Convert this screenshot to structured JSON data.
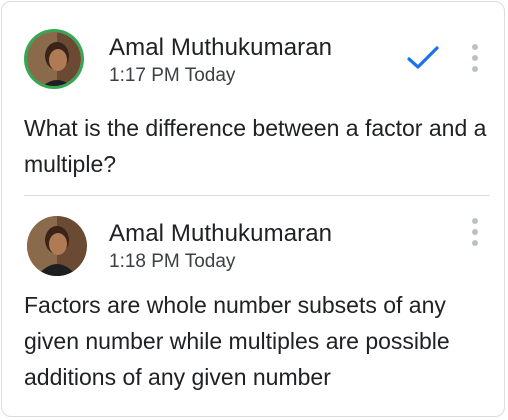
{
  "comments": [
    {
      "author": "Amal Muthukumaran",
      "time": "1:17 PM Today",
      "text": "What is the difference between a factor and a multiple?"
    },
    {
      "author": "Amal Muthukumaran",
      "time": "1:18 PM Today",
      "text": "Factors are whole number subsets of any given number while multiples are possible additions of any given number"
    }
  ],
  "icons": {
    "resolve": "checkmark-icon",
    "menu": "more-vert-icon"
  },
  "colors": {
    "accent": "#1a73e8",
    "ring": "#34a853",
    "divider": "#dadce0"
  }
}
